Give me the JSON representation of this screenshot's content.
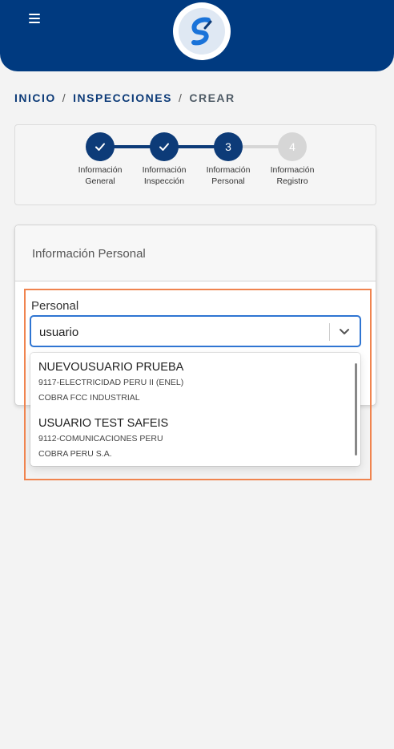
{
  "header": {
    "menu_icon": "hamburger-menu-icon",
    "logo_icon": "brand-logo-icon",
    "brand_color": "#003a80"
  },
  "breadcrumb": {
    "items": [
      "INICIO",
      "INSPECCIONES",
      "CREAR"
    ],
    "separator": "/"
  },
  "stepper": {
    "steps": [
      {
        "label": "Información\nGeneral",
        "state": "done",
        "content": "check-icon"
      },
      {
        "label": "Información\nInspección",
        "state": "done",
        "content": "check-icon"
      },
      {
        "label": "Información\nPersonal",
        "state": "active",
        "content": "3"
      },
      {
        "label": "Información\nRegistro",
        "state": "pending",
        "content": "4"
      }
    ],
    "colors": {
      "done": "#0d3b78",
      "pending": "#d6d6d6"
    }
  },
  "form": {
    "title": "Información Personal",
    "field_label": "Personal",
    "search_value": "usuario"
  },
  "dropdown": {
    "options": [
      {
        "name": "NUEVOUSUARIO PRUEBA",
        "line1": "9117-ELECTRICIDAD PERU II (ENEL)",
        "line2": "COBRA FCC INDUSTRIAL"
      },
      {
        "name": "USUARIO TEST SAFEIS",
        "line1": "9112-COMUNICACIONES PERU",
        "line2": "COBRA PERU S.A."
      }
    ]
  },
  "highlight_color": "#f0844f"
}
